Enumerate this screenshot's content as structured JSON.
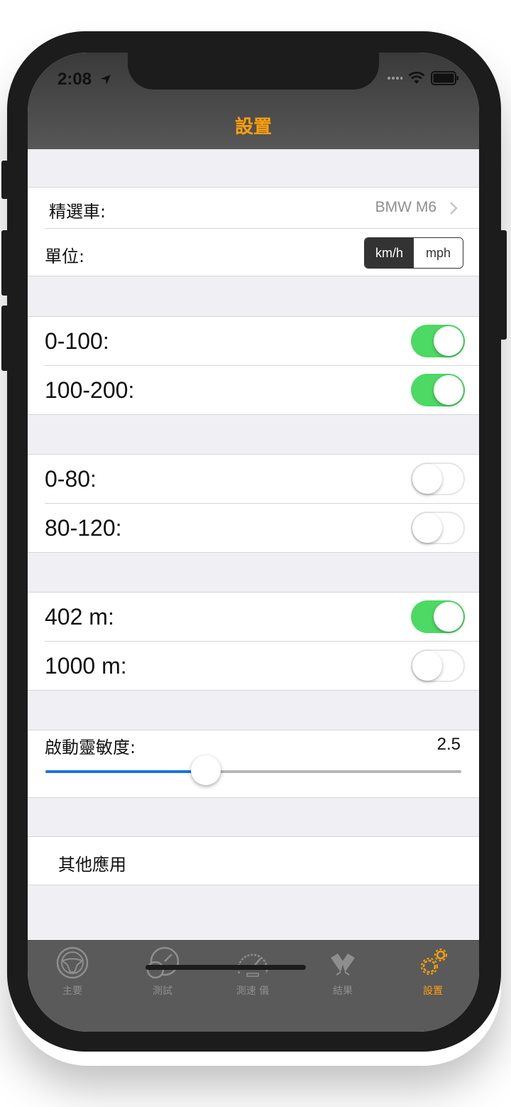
{
  "status": {
    "time": "2:08"
  },
  "nav": {
    "title": "設置"
  },
  "settings": {
    "car_label": "精選車:",
    "car_value": "BMW M6",
    "unit_label": "單位:",
    "unit_options": [
      "km/h",
      "mph"
    ],
    "unit_selected": "km/h"
  },
  "toggles": [
    {
      "label": "0-100:",
      "on": true
    },
    {
      "label": "100-200:",
      "on": true
    },
    {
      "label": "0-80:",
      "on": false
    },
    {
      "label": "80-120:",
      "on": false
    },
    {
      "label": "402 m:",
      "on": true
    },
    {
      "label": "1000 m:",
      "on": false
    }
  ],
  "sensitivity": {
    "label": "啟動靈敏度:",
    "value": "2.5",
    "fraction": 0.385
  },
  "other_apps": {
    "label": "其他應用"
  },
  "tabs": [
    {
      "label": "主要",
      "icon": "steering-wheel-icon"
    },
    {
      "label": "測試",
      "icon": "gauges-icon"
    },
    {
      "label": "測速 儀",
      "icon": "speedometer-icon"
    },
    {
      "label": "結果",
      "icon": "racing-flags-icon"
    },
    {
      "label": "設置",
      "icon": "gears-icon",
      "active": true
    }
  ],
  "colors": {
    "accent": "#ff9f0a",
    "toggle_on": "#4cd964",
    "slider_fill": "#1a73e8"
  }
}
